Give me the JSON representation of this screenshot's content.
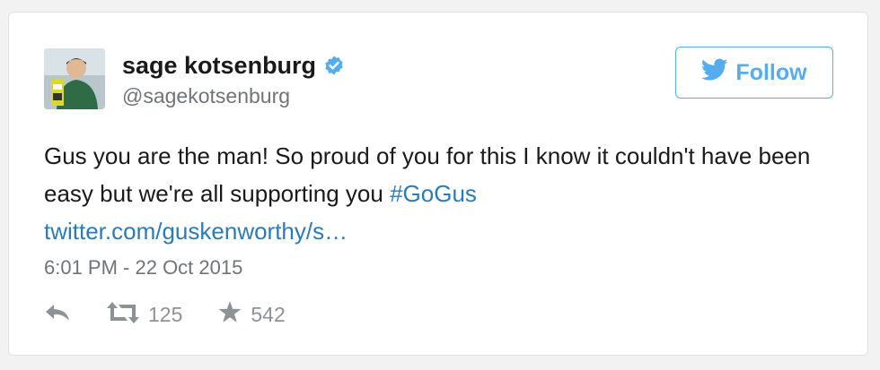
{
  "user": {
    "display_name": "sage kotsenburg",
    "handle": "@sagekotsenburg",
    "verified": true
  },
  "follow_button": {
    "label": "Follow"
  },
  "tweet": {
    "text_main": "Gus you are the man! So proud of you for this I know it couldn't have been easy but we're all supporting you ",
    "hashtag": "#GoGus",
    "link": "twitter.com/guskenworthy/s…",
    "timestamp": "6:01 PM - 22 Oct 2015"
  },
  "actions": {
    "retweet_count": "125",
    "favorite_count": "542"
  },
  "colors": {
    "accent": "#55acee",
    "link": "#2b7bb9",
    "muted": "#8d9297"
  },
  "icons": [
    "verified-badge-icon",
    "twitter-bird-icon",
    "reply-icon",
    "retweet-icon",
    "star-icon"
  ]
}
